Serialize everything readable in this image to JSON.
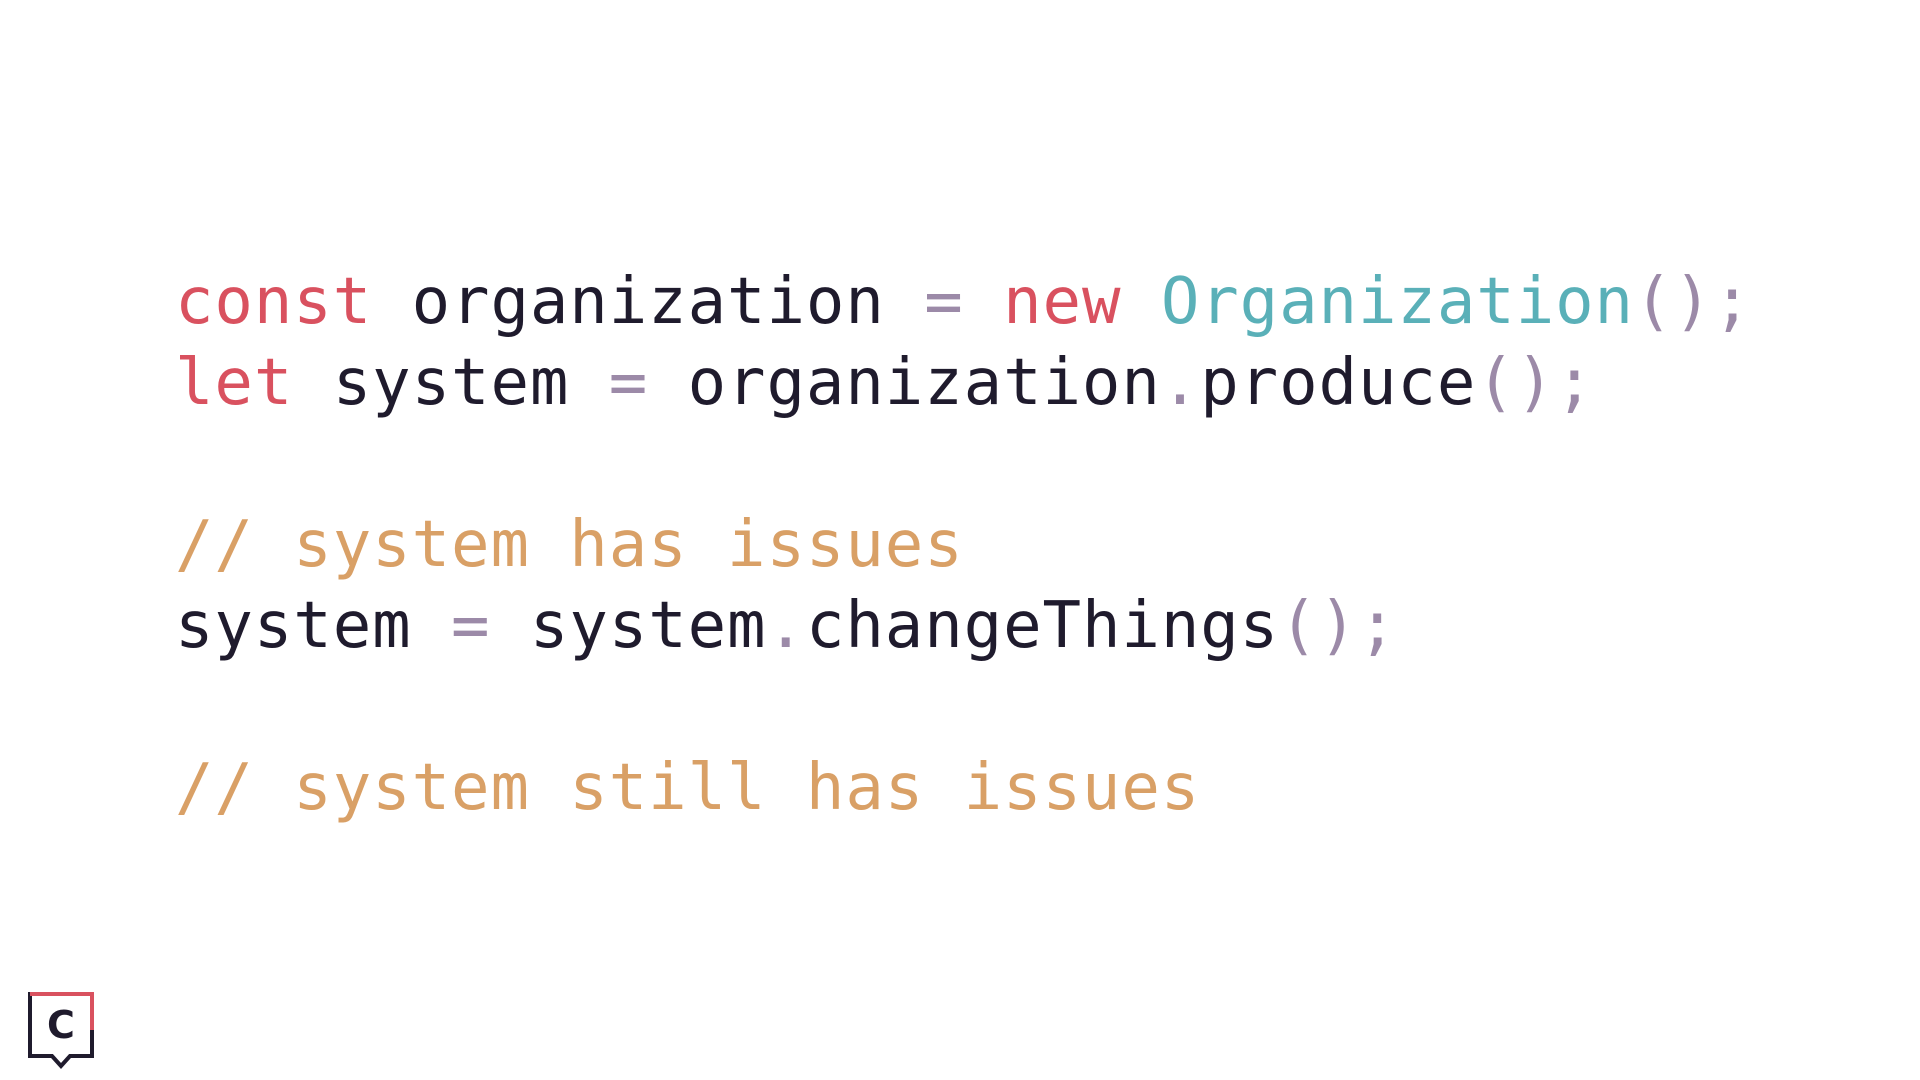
{
  "code": {
    "lines": [
      [
        {
          "t": "const",
          "k": "keyword"
        },
        {
          "t": " organization ",
          "k": "ident"
        },
        {
          "t": "=",
          "k": "op"
        },
        {
          "t": " ",
          "k": "ident"
        },
        {
          "t": "new",
          "k": "keyword"
        },
        {
          "t": " ",
          "k": "ident"
        },
        {
          "t": "Organization",
          "k": "class"
        },
        {
          "t": "();",
          "k": "punct"
        }
      ],
      [
        {
          "t": "let",
          "k": "keyword"
        },
        {
          "t": " system ",
          "k": "ident"
        },
        {
          "t": "=",
          "k": "op"
        },
        {
          "t": " organization",
          "k": "ident"
        },
        {
          "t": ".",
          "k": "punct"
        },
        {
          "t": "produce",
          "k": "ident"
        },
        {
          "t": "();",
          "k": "punct"
        }
      ],
      [],
      [
        {
          "t": "// system has issues",
          "k": "comment"
        }
      ],
      [
        {
          "t": "system ",
          "k": "ident"
        },
        {
          "t": "=",
          "k": "op"
        },
        {
          "t": " system",
          "k": "ident"
        },
        {
          "t": ".",
          "k": "punct"
        },
        {
          "t": "changeThings",
          "k": "ident"
        },
        {
          "t": "();",
          "k": "punct"
        }
      ],
      [],
      [
        {
          "t": "// system still has issues",
          "k": "comment"
        }
      ]
    ]
  },
  "colors": {
    "keyword": "#d9515f",
    "identifier": "#1f1b2d",
    "operator": "#9c8aa8",
    "class_name": "#5ab0b8",
    "comment": "#d9a066",
    "logo_frame": "#d9515f",
    "logo_letter": "#1f1b2d"
  },
  "logo": {
    "icon": "c-speech-bubble-logo-icon",
    "letter": "C"
  }
}
